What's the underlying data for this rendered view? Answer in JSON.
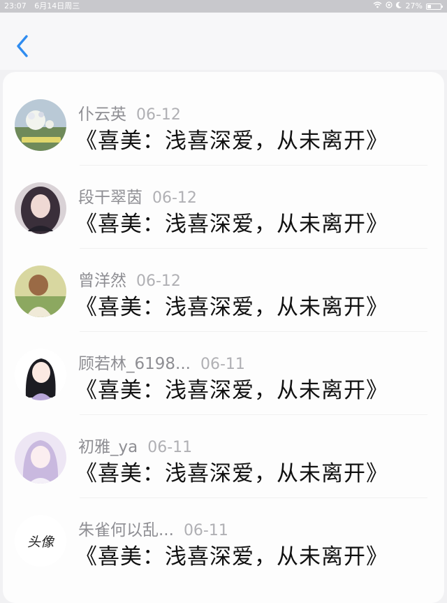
{
  "status_bar": {
    "time": "23:07",
    "date": "6月14日周三",
    "battery": "27%",
    "battery_level": 0.27
  },
  "navbar": {
    "back_icon": "chevron-left-icon",
    "accent": "#2f8cf0"
  },
  "comments": [
    {
      "name": "仆云英",
      "date": "06-12",
      "message": "《喜美：浅喜深爱，从未离开》",
      "avatar": "avatar-photo-flowers"
    },
    {
      "name": "段干翠茵",
      "date": "06-12",
      "message": "《喜美：浅喜深爱，从未离开》",
      "avatar": "avatar-photo-girl-dark-hair"
    },
    {
      "name": "曾洋然",
      "date": "06-12",
      "message": "《喜美：浅喜深爱，从未离开》",
      "avatar": "avatar-photo-girl-outdoor"
    },
    {
      "name": "顾若林_6198...",
      "date": "06-11",
      "message": "《喜美：浅喜深爱，从未离开》",
      "avatar": "avatar-anime-girl-black-hair"
    },
    {
      "name": "初雅_ya",
      "date": "06-11",
      "message": "《喜美：浅喜深爱，从未离开》",
      "avatar": "avatar-anime-girl-purple"
    },
    {
      "name": "朱雀何以乱...",
      "date": "06-11",
      "message": "《喜美：浅喜深爱，从未离开》",
      "avatar_text": "头像"
    }
  ]
}
